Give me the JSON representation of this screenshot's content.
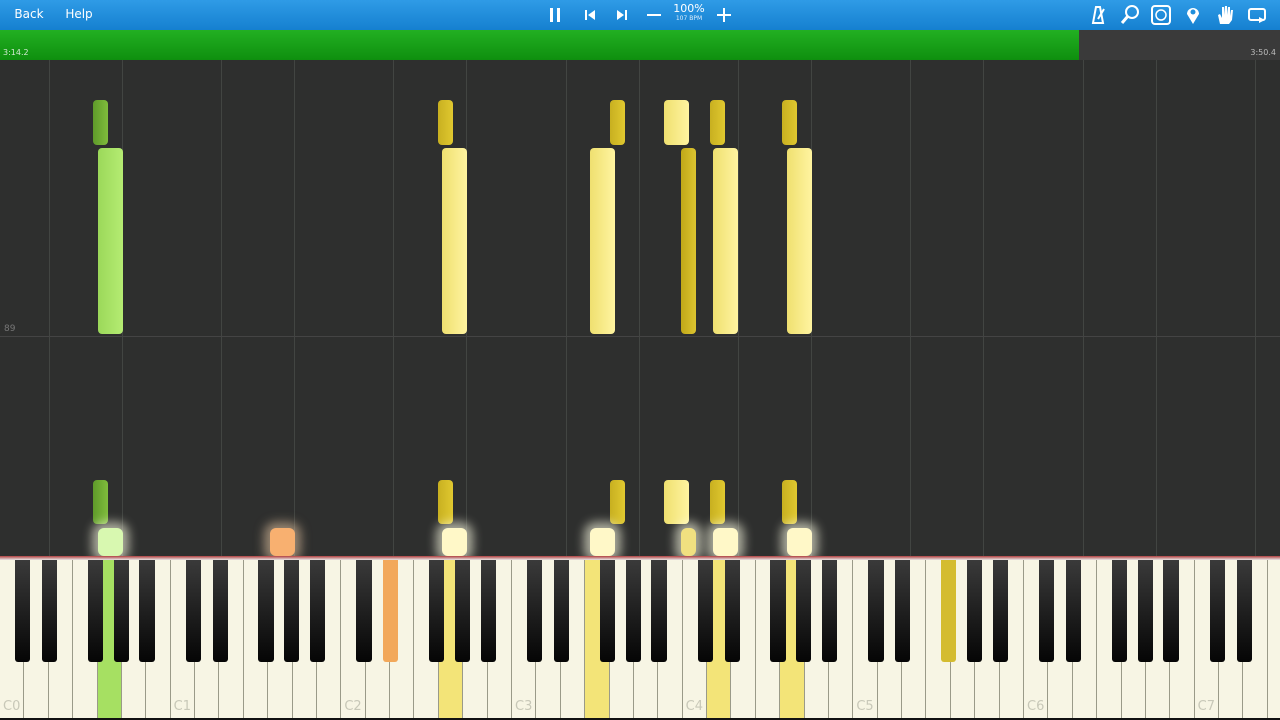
{
  "toolbar": {
    "back_label": "Back",
    "help_label": "Help",
    "zoom_percent": "100%",
    "tempo_bpm": "107 BPM",
    "icons": [
      "pause-icon",
      "skip-back-icon",
      "skip-forward-icon",
      "minus-icon",
      "plus-icon",
      "metronome-icon",
      "search-icon",
      "hands-icon",
      "location-pin-icon",
      "hand-icon",
      "loop-icon"
    ]
  },
  "progress": {
    "current_time": "3:14.2",
    "total_time": "3:50.4",
    "fraction": 0.843
  },
  "roll": {
    "measure_number": "89"
  },
  "keyboard": {
    "octave_labels": [
      "C0",
      "C1",
      "C2",
      "C3",
      "C4",
      "C5",
      "C6",
      "C7"
    ]
  },
  "colors": {
    "toolbar": "#1f8fdc",
    "progress_green": "#17a217",
    "note_green": "#a6e062",
    "note_yellow": "#f3e478",
    "note_orange": "#f2a85a"
  }
}
